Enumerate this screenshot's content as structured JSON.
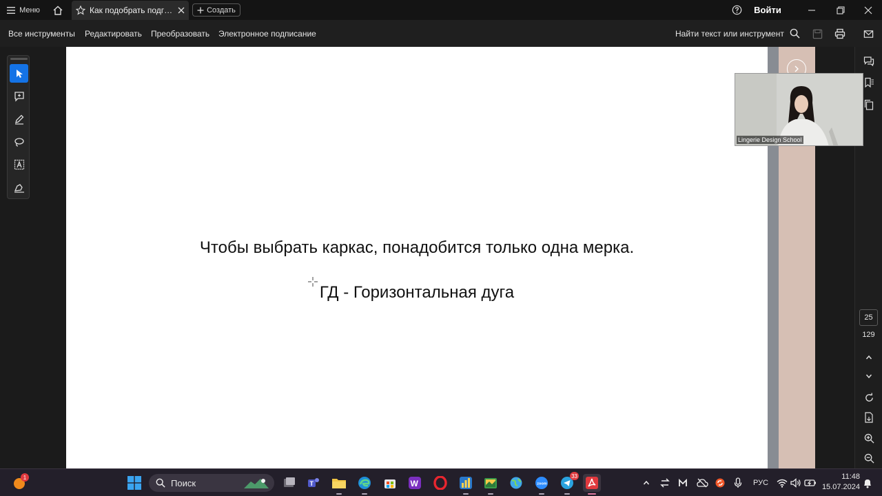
{
  "titlebar": {
    "menu_label": "Меню",
    "tab_title": "Как подобрать подгр...",
    "create_label": "Создать",
    "login_label": "Войти"
  },
  "toolbar": {
    "items": [
      "Все инструменты",
      "Редактировать",
      "Преобразовать",
      "Электронное подписание"
    ],
    "find_label": "Найти текст или инструмент"
  },
  "document": {
    "line1": "Чтобы выбрать каркас, понадобится только одна мерка.",
    "line2": "ГД - Горизонтальная дуга"
  },
  "video": {
    "label": "Lingerie Design School"
  },
  "navigation": {
    "current_page": "25",
    "total_pages": "129"
  },
  "taskbar": {
    "search_placeholder": "Поиск",
    "language": "РУС",
    "time": "11:48",
    "date": "15.07.2024",
    "notification_badge": "1",
    "telegram_badge": "33"
  },
  "colors": {
    "accent": "#1473e6",
    "acrobat_red": "#e0393e",
    "pink_panel": "#d6bfb4"
  }
}
